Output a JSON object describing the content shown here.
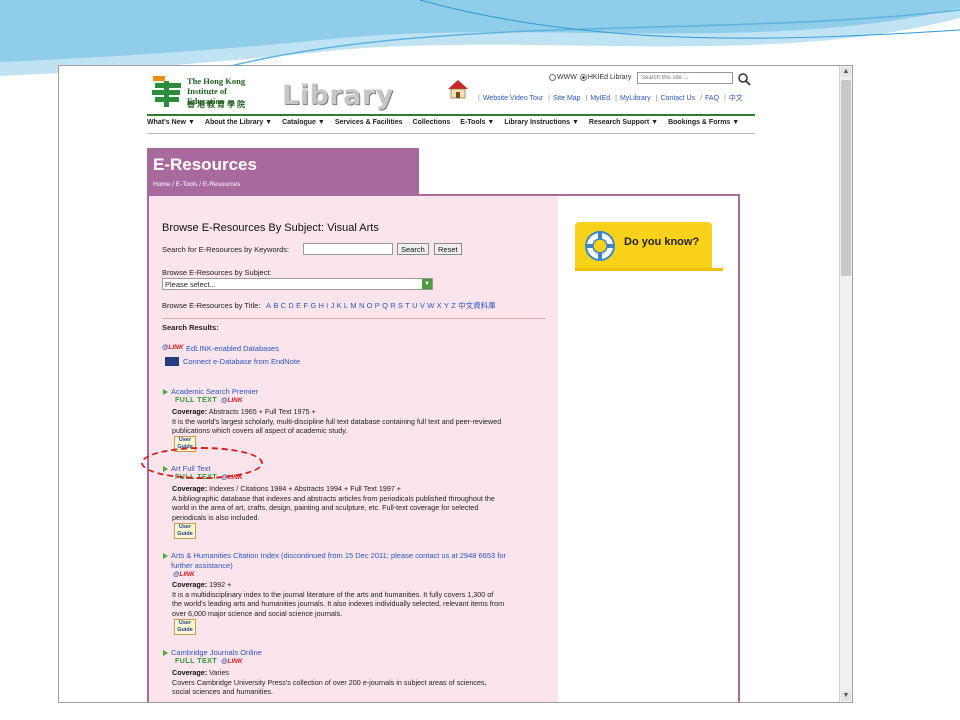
{
  "site": {
    "logo_en": "The Hong Kong Institute of Education",
    "logo_zh": "香港教育學院",
    "library_word": "Library",
    "scope_www": "WWW",
    "scope_hkied": "HKIEd Library",
    "search_placeholder": "Search this site ...",
    "toplinks": [
      "Website Video Tour",
      "Site Map",
      "MyIEd",
      "MyLibrary",
      "Contact Us",
      "FAQ",
      "中文"
    ],
    "nav": [
      "What's New ▼",
      "About the Library ▼",
      "Catalogue ▼",
      "Services & Facilities",
      "Collections",
      "E-Tools ▼",
      "Library Instructions ▼",
      "Research Support ▼",
      "Bookings & Forms ▼"
    ]
  },
  "banner": {
    "title": "E-Resources",
    "breadcrumb": "Home / E-Tools / E-Resources"
  },
  "browse": {
    "heading": "Browse E-Resources By Subject: Visual Arts",
    "keyword_label": "Search for E-Resources by Keywords:",
    "search_btn": "Search",
    "reset_btn": "Reset",
    "subject_label": "Browse E-Resources by Subject:",
    "subject_selected": "Please select...",
    "title_label": "Browse E-Resources by Title:",
    "letters": [
      "A",
      "B",
      "C",
      "D",
      "E",
      "F",
      "G",
      "H",
      "I",
      "J",
      "K",
      "L",
      "M",
      "N",
      "O",
      "P",
      "Q",
      "R",
      "S",
      "T",
      "U",
      "V",
      "W",
      "X",
      "Y",
      "Z",
      "中文資料庫"
    ],
    "results_heading": "Search Results:"
  },
  "tools": {
    "edlink": "EdLINK-enabled Databases",
    "endnote": "Connect e-Database from EndNote"
  },
  "badges": {
    "full_text": "FULL TEXT",
    "edlink": "LINK",
    "user_guide_1": "User",
    "user_guide_2": "Guide"
  },
  "results": [
    {
      "title": "Academic Search Premier",
      "coverage": "Abstracts 1965 + Full Text 1975 +",
      "desc_1": "It is the world's largest scholarly, multi-discipline full text database containing full text and peer-reviewed",
      "desc_2": "publications which covers all aspect of academic study."
    },
    {
      "title": "Art Full Text",
      "coverage": "Indexes / Citations 1984 + Abstracts 1994 + Full Text 1997 +",
      "desc_1": "A bibliographic database that indexes and abstracts articles from periodicals published throughout the",
      "desc_2": "world in the area of art, crafts, design, painting and sculpture, etc. Full-text coverage for selected",
      "desc_3": "periodicals is also included."
    },
    {
      "title_1": "Arts & Humanities Citation Index (discontinued from 15 Dec 2011; please contact us at 2948 6653 for",
      "title_2": "further assistance)",
      "coverage": "1992 +",
      "desc_1": "It is a multidisciplinary index to the journal literature of the arts and humanities. It fully covers 1,300 of",
      "desc_2": "the world's leading arts and humanities journals. It also indexes individually selected, relevant items from",
      "desc_3": "over 6,000 major science and social science journals."
    },
    {
      "title": "Cambridge Journals Online",
      "coverage": "Varies",
      "desc_1": "Covers Cambridge University Press's collection of over 200 e-journals in subject areas of sciences,",
      "desc_2": "social sciences and humanities."
    }
  ],
  "coverage_label": "Coverage:",
  "side": {
    "did_you_know": "Do you know?"
  },
  "colors": {
    "banner": "#a8699c",
    "content_bg": "#fbe4ec",
    "link": "#2a55c0",
    "accent_yellow": "#fbd21a",
    "annotation": "#d62020"
  }
}
